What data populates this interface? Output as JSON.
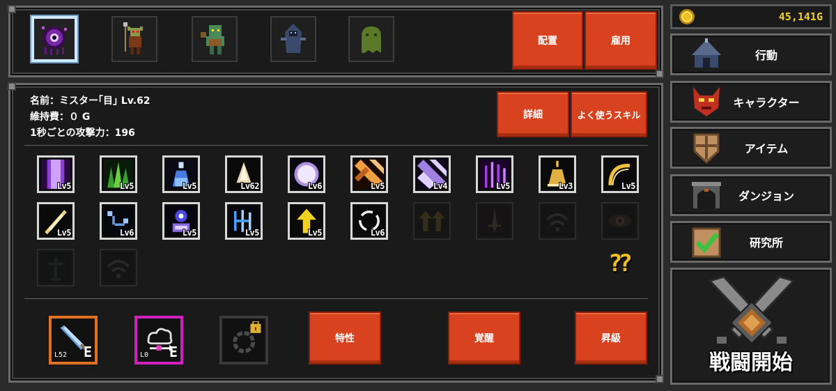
{
  "gold": "45,141G",
  "top_buttons": {
    "place": "配置",
    "hire": "雇用"
  },
  "characters": [
    {
      "name": "mister-eye",
      "selected": true
    },
    {
      "name": "goblin-spearman",
      "selected": false
    },
    {
      "name": "orc-brute",
      "selected": false
    },
    {
      "name": "hooded-wraith",
      "selected": false
    },
    {
      "name": "green-slime",
      "selected": false
    }
  ],
  "info": {
    "name_line": "名前：ミスター｢目｣ Lv.62",
    "upkeep_line": "維持費：０ G",
    "attack_line": "1秒ごとの攻撃力：196"
  },
  "info_buttons": {
    "detail": "詳細",
    "frequent_skills": "よく使うスキル"
  },
  "skills": [
    {
      "icon": "purple-beam",
      "level": "Lv5",
      "locked": false
    },
    {
      "icon": "green-grass",
      "level": "Lv5",
      "locked": false
    },
    {
      "icon": "potion",
      "level": "Lv5",
      "locked": false
    },
    {
      "icon": "fang",
      "level": "Lv62",
      "locked": false
    },
    {
      "icon": "white-orb",
      "level": "Lv6",
      "locked": false
    },
    {
      "icon": "orange-slash",
      "level": "Lv5",
      "locked": false
    },
    {
      "icon": "purple-slash",
      "level": "Lv4",
      "locked": false
    },
    {
      "icon": "purple-rays",
      "level": "Lv5",
      "locked": false
    },
    {
      "icon": "golden-bell",
      "level": "Lv3",
      "locked": false
    },
    {
      "icon": "golden-arc",
      "level": "Lv5",
      "locked": false
    },
    {
      "icon": "feather",
      "level": "Lv5",
      "locked": false
    },
    {
      "icon": "blue-chain",
      "level": "Lv6",
      "locked": false
    },
    {
      "icon": "blue-eye-figure",
      "level": "Lv5",
      "locked": false
    },
    {
      "icon": "blue-rune",
      "level": "Lv5",
      "locked": false
    },
    {
      "icon": "yellow-arrow",
      "level": "Lv5",
      "locked": false
    },
    {
      "icon": "white-ring",
      "level": "Lv6",
      "locked": false
    },
    {
      "icon": "double-arrow",
      "level": "",
      "locked": true
    },
    {
      "icon": "sword-aura",
      "level": "",
      "locked": true
    },
    {
      "icon": "signal-waves",
      "level": "",
      "locked": true
    },
    {
      "icon": "eye",
      "level": "",
      "locked": true
    },
    {
      "icon": "dark-tree",
      "level": "",
      "locked": true
    },
    {
      "icon": "signal-waves",
      "level": "",
      "locked": true
    }
  ],
  "equipment": [
    {
      "icon": "blue-sword",
      "level": "L52",
      "mark": "E",
      "frame_color": "#e07020"
    },
    {
      "icon": "cloud-arrow",
      "level": "L0",
      "mark": "E",
      "frame_color": "#d020c0"
    },
    {
      "icon": "dark-ring-locked",
      "level": "",
      "mark": "",
      "frame_color": "#3a3a3a"
    }
  ],
  "bottom_buttons": {
    "trait": "特性",
    "awaken": "覚醒",
    "promote": "昇級"
  },
  "menu": [
    {
      "label": "行動",
      "icon": "tent-icon"
    },
    {
      "label": "キャラクター",
      "icon": "demon-mask-icon"
    },
    {
      "label": "アイテム",
      "icon": "shield-icon"
    },
    {
      "label": "ダンジョン",
      "icon": "gate-icon"
    },
    {
      "label": "研究所",
      "icon": "checklist-icon"
    }
  ],
  "battle_label": "戦闘開始",
  "colors": {
    "red_button": "#d8421f",
    "gold": "#f0d030"
  }
}
